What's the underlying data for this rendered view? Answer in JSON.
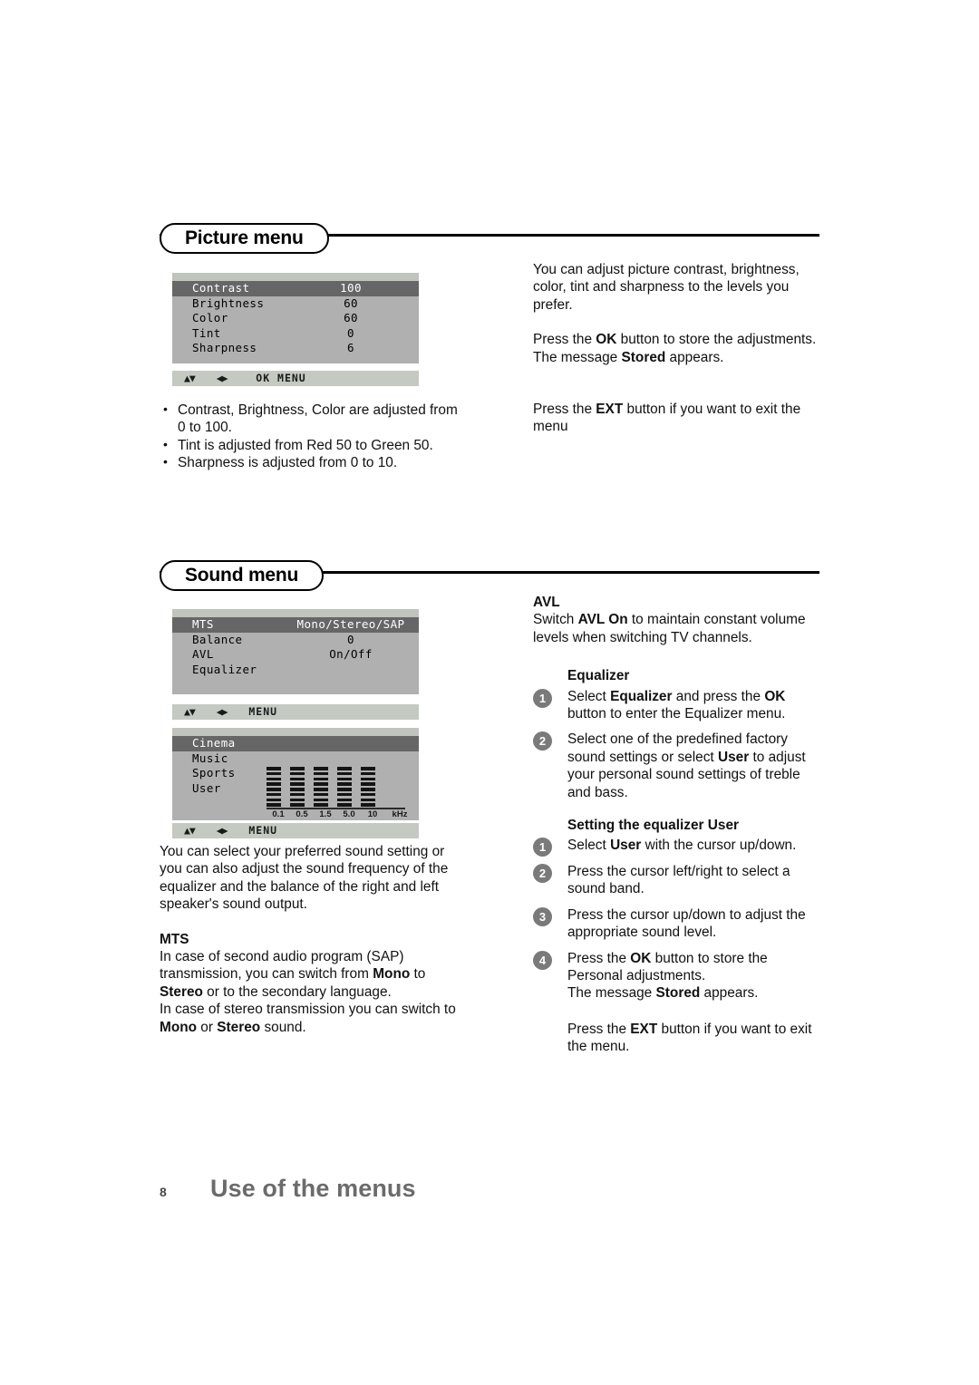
{
  "picture_section": {
    "heading": "Picture menu",
    "osd": {
      "rows": [
        {
          "label": "Contrast",
          "value": "100",
          "selected": true
        },
        {
          "label": "Brightness",
          "value": "60",
          "selected": false
        },
        {
          "label": "Color",
          "value": "60",
          "selected": false
        },
        {
          "label": "Tint",
          "value": "0",
          "selected": false
        },
        {
          "label": "Sharpness",
          "value": "6",
          "selected": false
        }
      ],
      "statusbar": {
        "arrows_vertical": "▲▼",
        "arrows_horizontal": "◀▶",
        "keys": "OK MENU"
      }
    },
    "bullets": [
      "Contrast, Brightness, Color are adjusted from 0 to 100.",
      "Tint is adjusted from Red 50 to Green 50.",
      "Sharpness is adjusted from 0 to 10."
    ],
    "right_paragraph_1": "You can adjust picture contrast, brightness, color, tint and sharpness to the levels you prefer.",
    "right_paragraph_2_a": "Press the ",
    "right_paragraph_2_ok": "OK",
    "right_paragraph_2_b": " button to store the adjustments. The message ",
    "right_paragraph_2_stored": "Stored",
    "right_paragraph_2_c": " appears.",
    "right_paragraph_3_a": "Press the ",
    "right_paragraph_3_ext": "EXT",
    "right_paragraph_3_b": " button if you want to exit the menu"
  },
  "sound_section": {
    "heading": "Sound menu",
    "osd_main": {
      "rows": [
        {
          "label": "MTS",
          "value": "Mono/Stereo/SAP",
          "selected": true
        },
        {
          "label": "Balance",
          "value": "0",
          "selected": false
        },
        {
          "label": "AVL",
          "value": "On/Off",
          "selected": false
        },
        {
          "label": "Equalizer",
          "value": "",
          "selected": false
        }
      ],
      "statusbar": {
        "arrows_vertical": "▲▼",
        "arrows_horizontal": "◀▶",
        "keys": "MENU"
      }
    },
    "osd_equalizer": {
      "rows": [
        {
          "label": "Cinema",
          "selected": true
        },
        {
          "label": "Music",
          "selected": false
        },
        {
          "label": "Sports",
          "selected": false
        },
        {
          "label": "User",
          "selected": false
        }
      ],
      "bands": [
        "0.1",
        "0.5",
        "1.5",
        "5.0",
        "10"
      ],
      "unit": "kHz",
      "segments_per_band": 8,
      "statusbar": {
        "arrows_vertical": "▲▼",
        "arrows_horizontal": "◀▶",
        "keys": "MENU"
      }
    },
    "left_paragraph": "You can select your preferred sound setting or you can also adjust the sound frequency of the equalizer and the balance of the right and left speaker's sound output.",
    "mts_heading": "MTS",
    "mts_p1_a": "In case of second audio program (SAP) transmission, you can switch from ",
    "mts_p1_mono": "Mono",
    "mts_p1_b": " to ",
    "mts_p1_stereo": "Stereo",
    "mts_p1_c": " or to the secondary language.",
    "mts_p2_a": "In case of stereo transmission you can switch to ",
    "mts_p2_mono": "Mono",
    "mts_p2_b": " or ",
    "mts_p2_stereo": "Stereo",
    "mts_p2_c": " sound.",
    "avl_heading": "AVL",
    "avl_p_a": "Switch ",
    "avl_p_bold": "AVL On",
    "avl_p_b": " to maintain constant volume levels when switching TV channels.",
    "equalizer_heading": "Equalizer",
    "eq_steps": [
      {
        "number": "1",
        "a": "Select ",
        "bold1": "Equalizer",
        "b": " and press the ",
        "bold2": "OK",
        "c": " button to enter the Equalizer menu."
      },
      {
        "number": "2",
        "a": "Select one of the predefined factory sound settings or select ",
        "bold1": "User",
        "b": " to adjust your personal sound settings of treble and bass.",
        "bold2": "",
        "c": ""
      }
    ],
    "user_heading": "Setting the equalizer User",
    "user_steps": [
      {
        "number": "1",
        "a": "Select ",
        "bold1": "User",
        "b": " with the cursor up/down.",
        "bold2": "",
        "c": ""
      },
      {
        "number": "2",
        "a": "Press the cursor left/right to select a sound band.",
        "bold1": "",
        "b": "",
        "bold2": "",
        "c": ""
      },
      {
        "number": "3",
        "a": "Press the cursor up/down to adjust the appropriate sound level.",
        "bold1": "",
        "b": "",
        "bold2": "",
        "c": ""
      },
      {
        "number": "4",
        "a": "Press the ",
        "bold1": "OK",
        "b": " button to store the Personal adjustments.",
        "bold2": "",
        "c": ""
      }
    ],
    "user_step4_extra_a": "The message ",
    "user_step4_extra_bold": "Stored",
    "user_step4_extra_b": " appears.",
    "exit_p_a": "Press the ",
    "exit_p_ext": "EXT",
    "exit_p_b": " button if you want to exit the menu."
  },
  "footer": {
    "page_number": "8",
    "title": "Use of the menus"
  },
  "colors": {
    "osd_bg": "#b0b0b0",
    "osd_selected": "#666666",
    "osd_statusbar": "#c4c9c2",
    "badge": "#7a7a7a",
    "footer_title": "#6b6b6b"
  }
}
